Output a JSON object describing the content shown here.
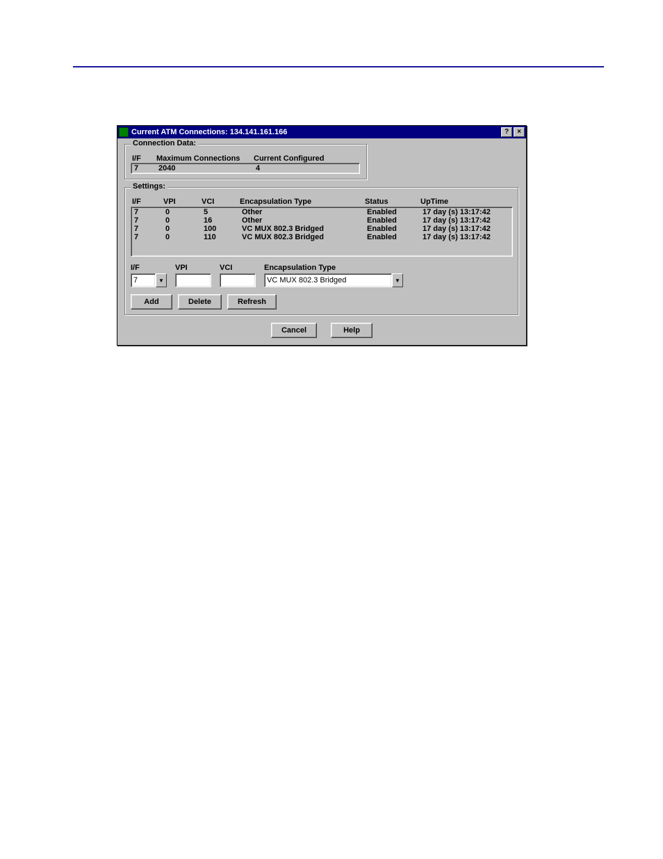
{
  "window": {
    "title": "Current ATM Connections: 134.141.161.166",
    "help_btn": "?",
    "close_btn": "×"
  },
  "connection_data": {
    "legend": "Connection Data:",
    "headers": {
      "if": "I/F",
      "max": "Maximum Connections",
      "cur": "Current Configured"
    },
    "row": {
      "if": "7",
      "max": "2040",
      "cur": "4"
    }
  },
  "settings": {
    "legend": "Settings:",
    "headers": {
      "if": "I/F",
      "vpi": "VPI",
      "vci": "VCI",
      "enc": "Encapsulation Type",
      "status": "Status",
      "uptime": "UpTime"
    },
    "rows": [
      {
        "if": "7",
        "vpi": "0",
        "vci": "5",
        "enc": "Other",
        "status": "Enabled",
        "uptime": "17 day (s) 13:17:42"
      },
      {
        "if": "7",
        "vpi": "0",
        "vci": "16",
        "enc": "Other",
        "status": "Enabled",
        "uptime": "17 day (s) 13:17:42"
      },
      {
        "if": "7",
        "vpi": "0",
        "vci": "100",
        "enc": "VC MUX 802.3 Bridged",
        "status": "Enabled",
        "uptime": "17 day (s) 13:17:42"
      },
      {
        "if": "7",
        "vpi": "0",
        "vci": "110",
        "enc": "VC MUX 802.3 Bridged",
        "status": "Enabled",
        "uptime": "17 day (s) 13:17:42"
      }
    ]
  },
  "form": {
    "labels": {
      "if": "I/F",
      "vpi": "VPI",
      "vci": "VCI",
      "enc": "Encapsulation Type"
    },
    "values": {
      "if": "7",
      "vpi": "",
      "vci": "",
      "enc": "VC MUX 802.3 Bridged"
    }
  },
  "buttons": {
    "add": "Add",
    "delete": "Delete",
    "refresh": "Refresh",
    "cancel": "Cancel",
    "help": "Help"
  }
}
